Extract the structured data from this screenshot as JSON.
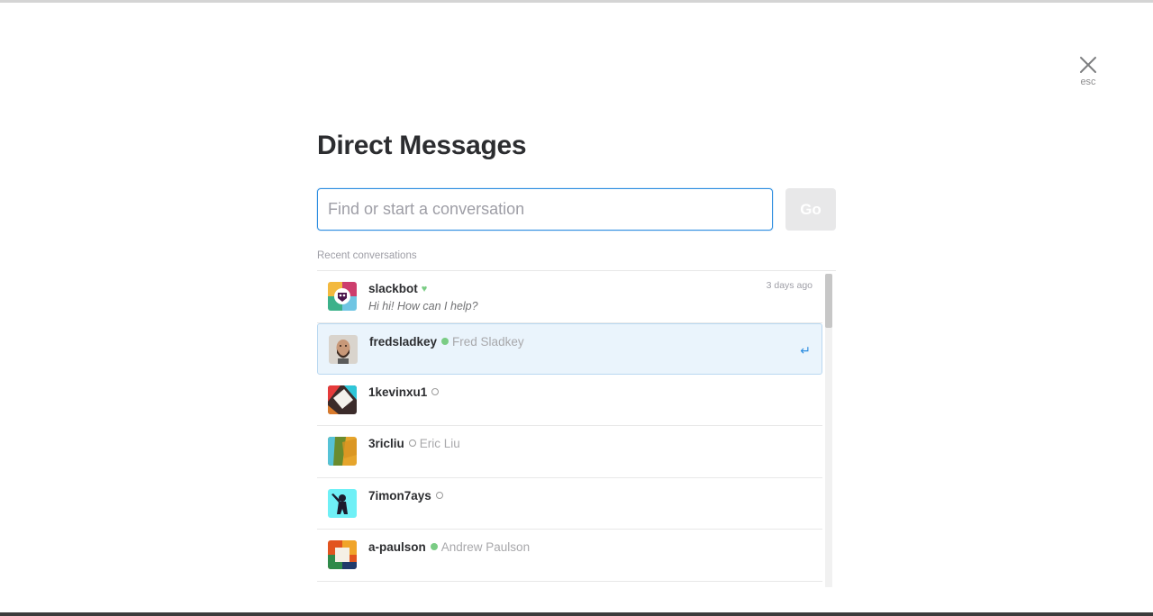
{
  "close": {
    "label": "esc"
  },
  "title": "Direct Messages",
  "search": {
    "placeholder": "Find or start a conversation",
    "value": ""
  },
  "go_label": "Go",
  "recent_label": "Recent conversations",
  "conversations": [
    {
      "username": "slackbot",
      "status": "heart",
      "real_name": "",
      "preview": "Hi hi! How can I help?",
      "time": "3 days ago"
    },
    {
      "username": "fredsladkey",
      "status": "active",
      "real_name": "Fred Sladkey",
      "preview": "",
      "time": "",
      "selected": true
    },
    {
      "username": "1kevinxu1",
      "status": "away",
      "real_name": "",
      "preview": "",
      "time": ""
    },
    {
      "username": "3ricliu",
      "status": "away",
      "real_name": "Eric Liu",
      "preview": "",
      "time": ""
    },
    {
      "username": "7imon7ays",
      "status": "away",
      "real_name": "",
      "preview": "",
      "time": ""
    },
    {
      "username": "a-paulson",
      "status": "active",
      "real_name": "Andrew Paulson",
      "preview": "",
      "time": ""
    }
  ],
  "icons": {
    "close": "close-icon",
    "enter": "return-icon",
    "heart": "heart-icon"
  },
  "colors": {
    "accent": "#2d8de0",
    "active_status": "#7acc84",
    "selected_row_bg": "#eaf4fc"
  }
}
